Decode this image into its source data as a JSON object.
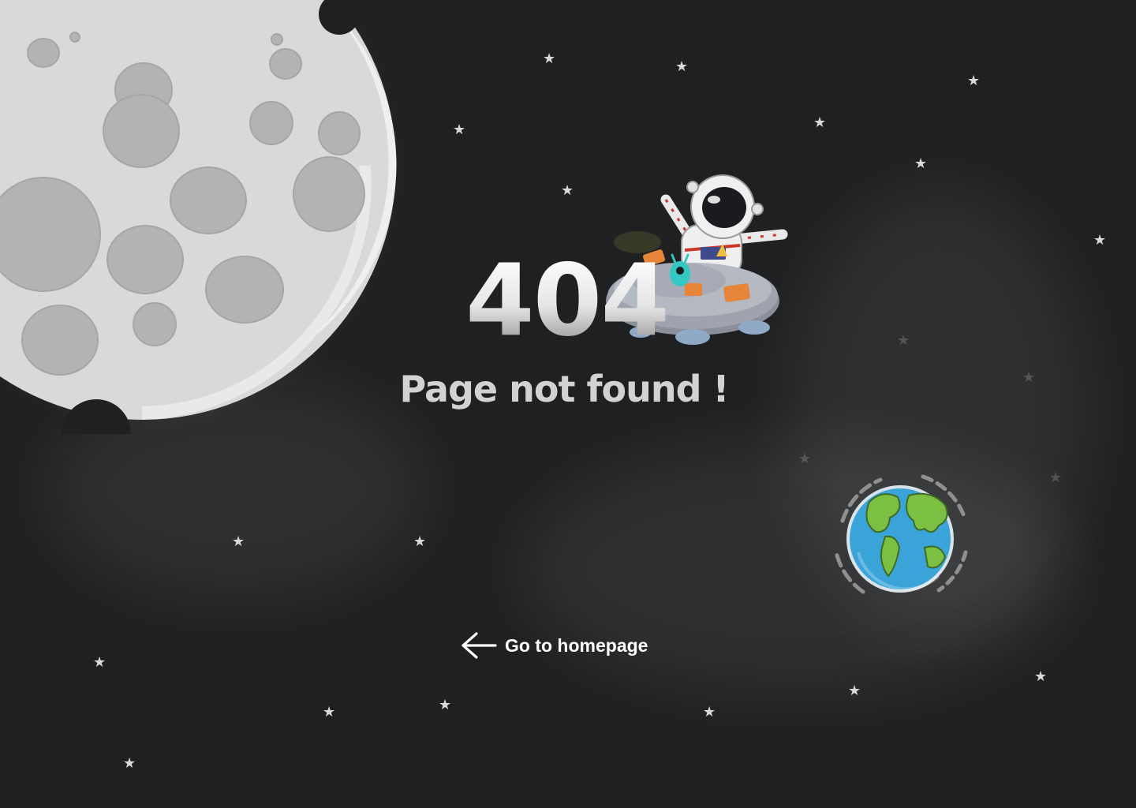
{
  "error": {
    "code": "404",
    "message": "Page not found !"
  },
  "nav": {
    "home_label": "Go to homepage",
    "home_icon": "arrow-left-icon"
  },
  "illustration": {
    "moon": "moon-illustration",
    "astronaut": "astronaut-on-ufo-illustration",
    "earth": "earth-illustration",
    "star_glyph": "★"
  },
  "colors": {
    "background": "#1f2022",
    "text_primary": "#ffffff",
    "text_secondary": "#d2d2d2",
    "moon": "#d9d9d9",
    "earth_ocean": "#3aa3d8",
    "earth_land": "#7cc043"
  }
}
